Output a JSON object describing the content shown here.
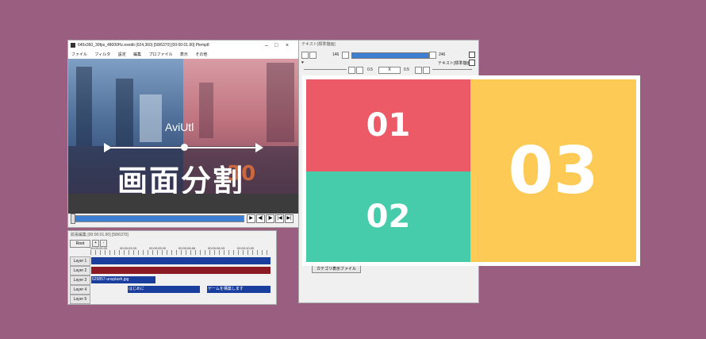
{
  "colors": {
    "background": "#9a5f80",
    "accent_blue": "#3d7fd3",
    "cell_01": "#ec5a68",
    "cell_02": "#46ccaa",
    "cell_03": "#fdca56"
  },
  "main_window": {
    "title": "640x360_30fps_48000Hz.exedit (624,360)  [58/6370]  [00:00:01.90]  Plemp8",
    "controls": [
      "–",
      "□",
      "×"
    ],
    "menu": [
      "ファイル",
      "フィルタ",
      "設定",
      "編集",
      "プロファイル",
      "表示",
      "その他"
    ],
    "overlay_label": "AviUtl",
    "overlay_title": "画面分割",
    "road_mark": "30",
    "playback_buttons": [
      "▶",
      "◀|",
      "|▶",
      "|◀",
      "▶|"
    ]
  },
  "timeline": {
    "title": "拡張編集 [00:00:01.90] [58/6370]",
    "root_label": "Root",
    "small_buttons": [
      "+",
      "-"
    ],
    "timecodes": [
      "00:00:00.00",
      "00:00:03.33",
      "00:00:05.00",
      "00:00:06.66",
      "00:00:08.33",
      "00:00:10.00"
    ],
    "layers": [
      {
        "label": "Layer 1",
        "clips": [
          {
            "text": "",
            "color": "#1a3e9e"
          }
        ]
      },
      {
        "label": "Layer 2",
        "clips": [
          {
            "text": "",
            "color": "#8b1a24"
          }
        ]
      },
      {
        "label": "Layer 3",
        "clips": [
          {
            "text": "629857-unsplash.jpg",
            "color": "#1a3e9e"
          }
        ]
      },
      {
        "label": "Layer 4",
        "clips": [
          {
            "text": "はじめに",
            "color": "#1a3e9e"
          },
          {
            "text": "ゲームを構築します",
            "color": "#1a3e9e"
          }
        ]
      },
      {
        "label": "Layer 5",
        "clips": []
      }
    ]
  },
  "text_window": {
    "title": "テキスト[標準描画]",
    "slider_left": "146",
    "slider_right": "246",
    "checkbox_label": "テキスト[標準描画]",
    "row2_left_val": "0.5",
    "row2_center_val": "X",
    "row2_right_val": "0.5",
    "bottom_button": "カテゴリ表示ファイル"
  },
  "grid": {
    "cell_01": "01",
    "cell_02": "02",
    "cell_03": "03"
  }
}
